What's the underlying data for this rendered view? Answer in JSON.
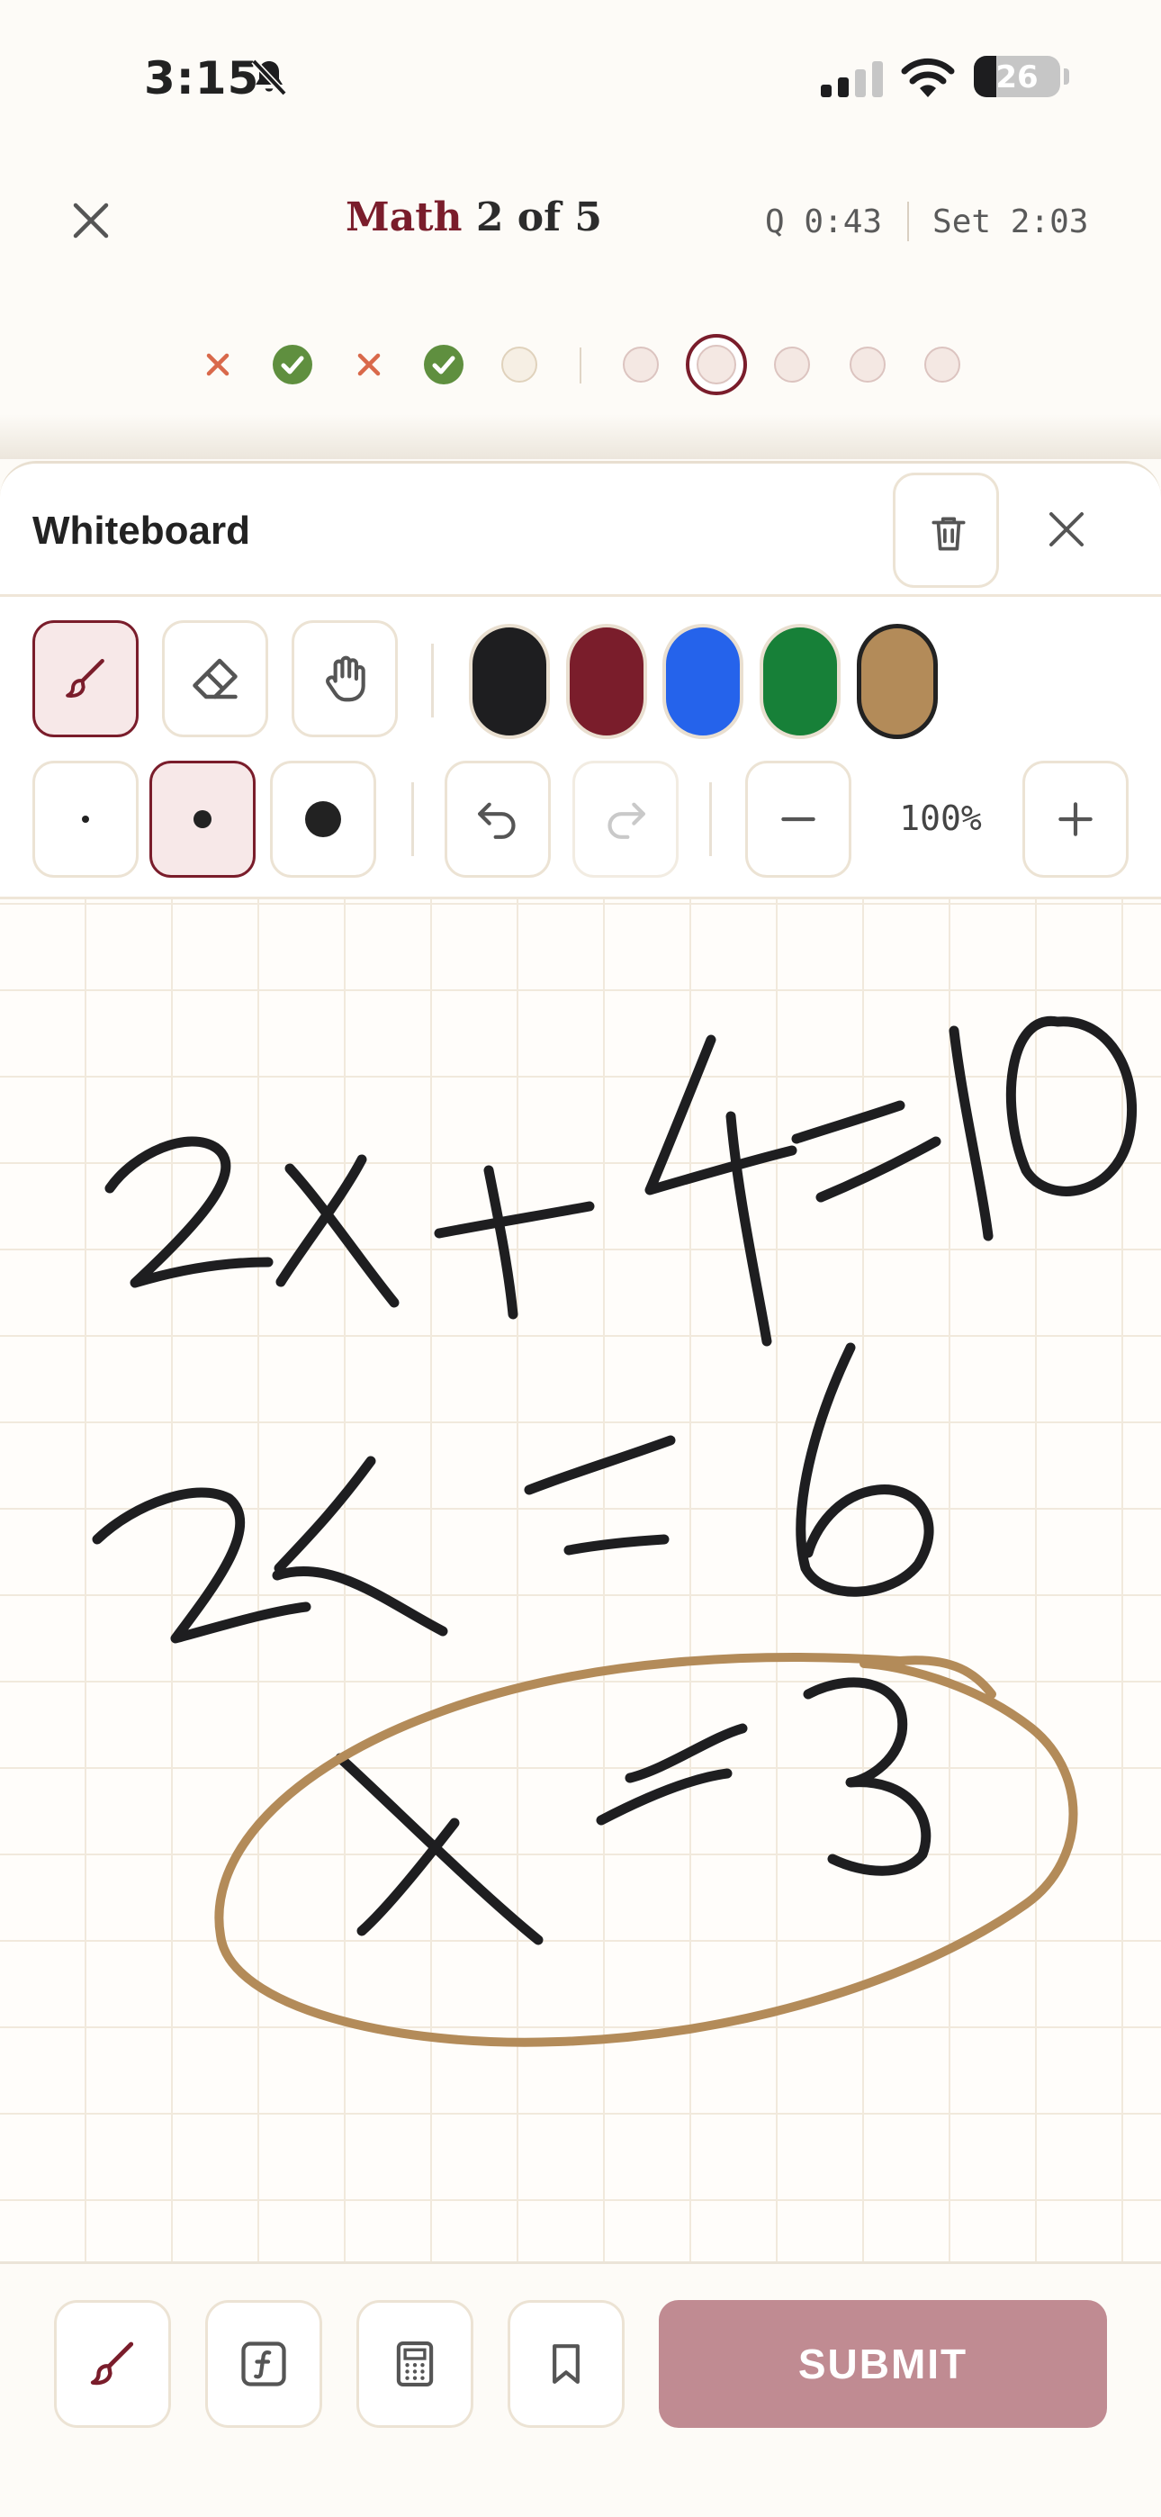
{
  "status_bar": {
    "time": "3:15",
    "battery": "26",
    "battery_level": 0.26
  },
  "header": {
    "subject": "Math",
    "progress": "2 of 5",
    "question_timer": "Q 0:43",
    "set_timer": "Set 2:03"
  },
  "progress_dots": [
    {
      "state": "wrong"
    },
    {
      "state": "correct"
    },
    {
      "state": "wrong"
    },
    {
      "state": "correct"
    },
    {
      "state": "unanswered"
    },
    {
      "state": "unanswered"
    },
    {
      "state": "current"
    },
    {
      "state": "unanswered"
    },
    {
      "state": "unanswered"
    },
    {
      "state": "unanswered"
    }
  ],
  "whiteboard": {
    "title": "Whiteboard",
    "tools": [
      "pen",
      "eraser",
      "pan"
    ],
    "active_tool": "pen",
    "colors": [
      "#1e1e20",
      "#7a1d2b",
      "#2563eb",
      "#178038",
      "#b38b59"
    ],
    "selected_color": "#b38b59",
    "stroke_sizes": [
      "small",
      "medium",
      "large"
    ],
    "active_stroke": "medium",
    "zoom": "100%",
    "redo_enabled": false
  },
  "bottom_bar": {
    "buttons": [
      "pen-icon",
      "formula-icon",
      "calculator-icon",
      "bookmark-icon"
    ],
    "submit_label": "SUBMIT"
  },
  "colors": {
    "accent": "#7a1d2b",
    "correct": "#5f8f3f",
    "wrong": "#d9694b",
    "submit_bg": "#c08b92"
  }
}
